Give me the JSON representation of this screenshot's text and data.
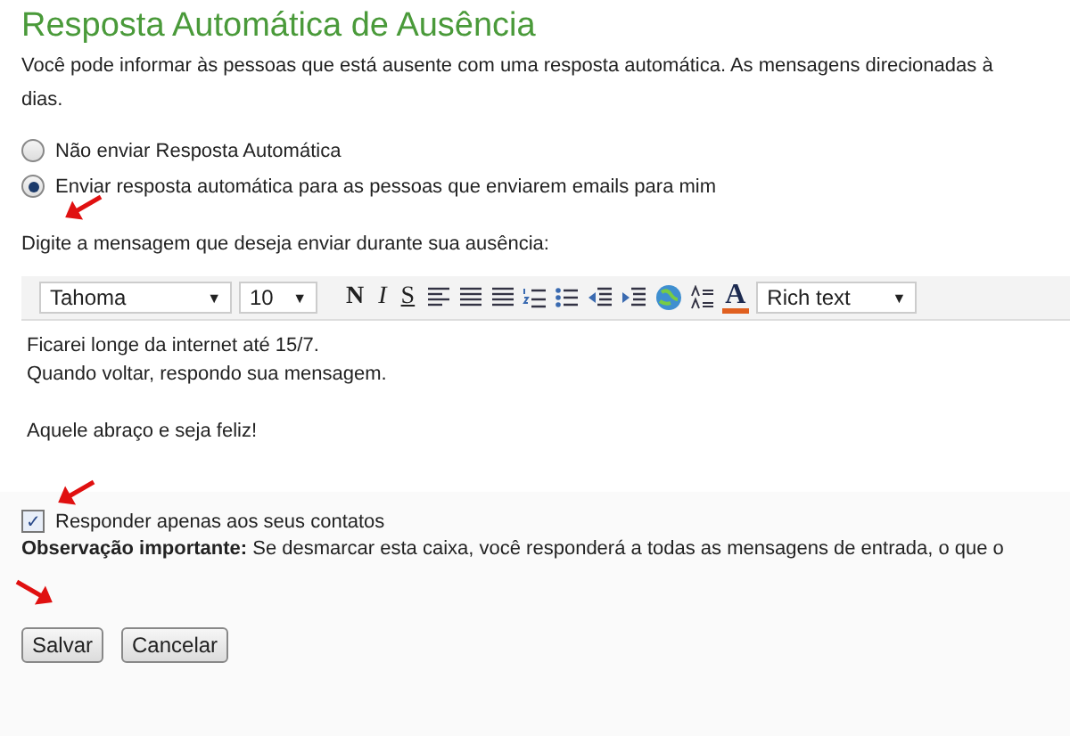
{
  "title": "Resposta Automática de Ausência",
  "description_lines": [
    "Você pode informar às pessoas que está ausente com uma resposta automática. As mensagens direcionadas à",
    "dias."
  ],
  "reply_options": [
    {
      "label": "Não enviar Resposta Automática",
      "selected": false
    },
    {
      "label": "Enviar resposta automática para as pessoas que enviarem emails para mim",
      "selected": true
    }
  ],
  "message_prompt": "Digite a mensagem que deseja enviar durante sua ausência:",
  "toolbar": {
    "font": "Tahoma",
    "size": "10",
    "caret": "▼",
    "bold": "N",
    "italic": "I",
    "underline": "S",
    "font_color": "A",
    "format": "Rich text"
  },
  "message_paragraphs": [
    [
      "Ficarei longe da internet até 15/7.",
      "Quando voltar, respondo sua mensagem."
    ],
    [
      "Aquele abraço e seja feliz!"
    ]
  ],
  "contacts_only": {
    "label": "Responder apenas aos seus contatos",
    "checked": true,
    "check_mark": "✓"
  },
  "note": "**Observação importante:** Se desmarcar esta caixa, você responderá a todas as mensagens de entrada, o que o",
  "buttons": [
    "Salvar",
    "Cancelar"
  ]
}
